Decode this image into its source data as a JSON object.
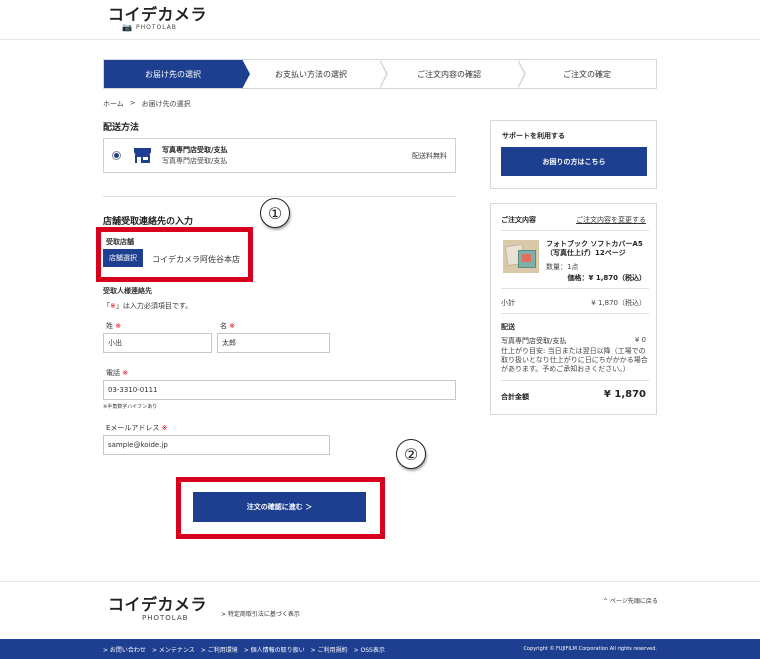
{
  "header": {
    "logo_main": "コイデカメラ",
    "logo_sub": "PHOTOLAB"
  },
  "steps": [
    {
      "label": "お届け先の選択",
      "active": true
    },
    {
      "label": "お支払い方法の選択",
      "active": false
    },
    {
      "label": "ご注文内容の確認",
      "active": false
    },
    {
      "label": "ご注文の確定",
      "active": false
    }
  ],
  "breadcrumb": {
    "home": "ホーム",
    "separator": ">",
    "current": "お届け先の選択"
  },
  "delivery": {
    "title": "配送方法",
    "option_title": "写真専門店受取/支払",
    "option_sub": "写真専門店受取/支払",
    "fee": "配送料無料"
  },
  "store_contact": {
    "title": "店舗受取連絡先の入力",
    "store_label": "受取店舗",
    "store_button": "店舗選択",
    "store_name": "コイデカメラ阿佐谷本店",
    "recipient_label": "受取人様連絡先",
    "required_note_open": "「",
    "required_mark": "※",
    "required_note_close": "」は入力必須項目です。",
    "last_name_label": "姓",
    "last_name_value": "小出",
    "first_name_label": "名",
    "first_name_value": "太郎",
    "phone_label": "電話",
    "phone_value": "03-3310-0111",
    "phone_note": "※半角数字ハイフンあり",
    "email_label": "Eメールアドレス",
    "email_value": "sample@koide.jp",
    "confirm_button": "注文の確認に進む ＞"
  },
  "annotations": {
    "circle1": "①",
    "circle2": "②"
  },
  "support": {
    "title": "サポートを利用する",
    "help_button": "お困りの方はこちら"
  },
  "order": {
    "title": "ご注文内容",
    "change_link": "ご注文内容を変更する",
    "product_name": "フォトブック ソフトカバーA5（写真仕上げ）12ページ",
    "quantity": "数量：1点",
    "price": "価格：¥ 1,870（税込）",
    "subtotal_label": "小計",
    "subtotal_value": "¥ 1,870（税込）",
    "shipping_label": "配送",
    "shipping_method": "写真専門店受取/支払",
    "shipping_value": "¥ 0",
    "shipping_note": "仕上がり目安: 当日または翌日以降（工場での取り扱いとなり仕上がりに日にちがかかる場合があります。予めご承知おきください。）",
    "total_label": "合計金額",
    "total_value": "¥ 1,870"
  },
  "footer": {
    "logo_main": "コイデカメラ",
    "logo_sub": "PHOTOLAB",
    "legal_link": "> 特定商取引法に基づく表示",
    "pagetop": "^ ページ先頭に戻る",
    "nav": [
      "> お問い合わせ",
      "> メンテナンス",
      "> ご利用環境",
      "> 個人情報の取り扱い",
      "> ご利用規約",
      "> OSS表示"
    ],
    "copyright": "Copyright © FUJIFILM Corporation All rights reserved."
  },
  "colors": {
    "brand_blue": "#1e3f8f",
    "annotation_red": "#d8001c"
  }
}
